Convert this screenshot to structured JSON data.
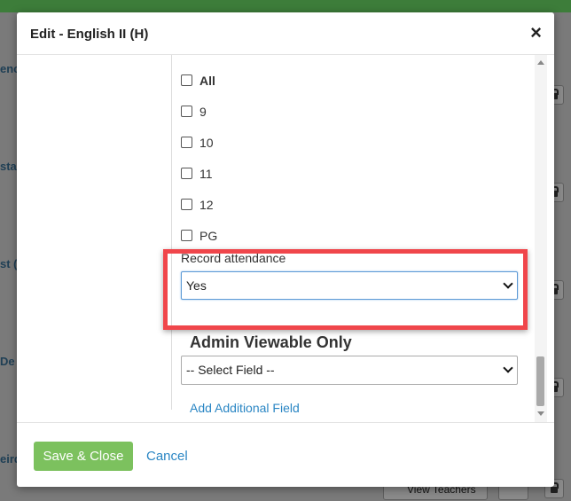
{
  "background": {
    "fragments": [
      "enc",
      "sta",
      "st (",
      "De",
      "eird"
    ],
    "view_teachers_label": "View Teachers"
  },
  "modal": {
    "title": "Edit - English II (H)",
    "close_label": "×",
    "grade_options": [
      {
        "label": "All",
        "checked": false
      },
      {
        "label": "9",
        "checked": false
      },
      {
        "label": "10",
        "checked": false
      },
      {
        "label": "11",
        "checked": false
      },
      {
        "label": "12",
        "checked": false
      },
      {
        "label": "PG",
        "checked": false
      }
    ],
    "record_attendance": {
      "label": "Record attendance",
      "value": "Yes"
    },
    "admin_section_title": "Admin Viewable Only",
    "select_field": {
      "value": "-- Select Field --"
    },
    "add_field_label": "Add Additional Field",
    "footer": {
      "save_label": "Save & Close",
      "cancel_label": "Cancel"
    }
  },
  "colors": {
    "accent_green": "#7cc15e",
    "link_blue": "#2a86c4",
    "highlight_red": "#f0464b"
  }
}
